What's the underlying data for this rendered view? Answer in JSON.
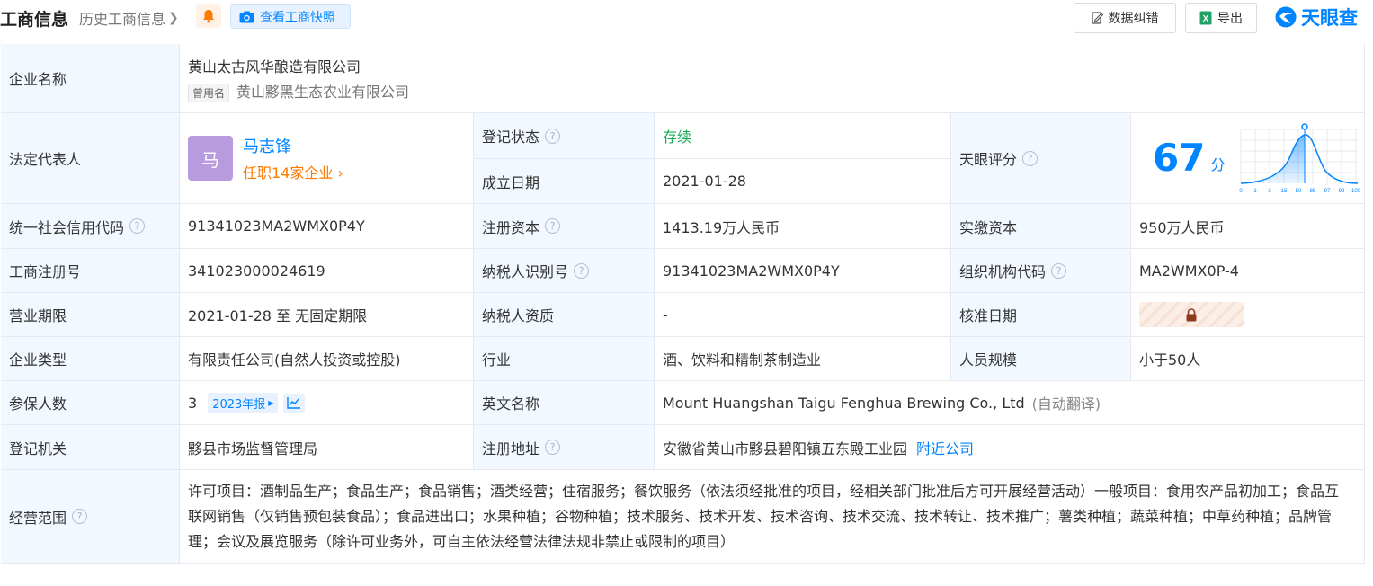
{
  "header": {
    "title": "工商信息",
    "history_link": "历史工商信息",
    "snapshot_button": "查看工商快照",
    "correct_button": "数据纠错",
    "export_button": "导出",
    "brand": "天眼查"
  },
  "company": {
    "label_name": "企业名称",
    "name": "黄山太古风华酿造有限公司",
    "former_tag": "曾用名",
    "former_name": "黄山黟黑生态农业有限公司"
  },
  "legal_rep": {
    "label": "法定代表人",
    "avatar_char": "马",
    "name": "马志锋",
    "jobs": "任职14家企业"
  },
  "reg_status": {
    "label": "登记状态",
    "value": "存续"
  },
  "founded": {
    "label": "成立日期",
    "value": "2021-01-28"
  },
  "score": {
    "label": "天眼评分",
    "value": "67",
    "unit": "分",
    "axis_ticks": [
      "0",
      "1",
      "3",
      "15",
      "50",
      "85",
      "97",
      "99",
      "100"
    ],
    "marker_tick": "50"
  },
  "rows": {
    "credit_code": {
      "label": "统一社会信用代码",
      "value": "91341023MA2WMX0P4Y"
    },
    "reg_capital": {
      "label": "注册资本",
      "value": "1413.19万人民币"
    },
    "paid_capital": {
      "label": "实缴资本",
      "value": "950万人民币"
    },
    "biz_reg_no": {
      "label": "工商注册号",
      "value": "341023000024619"
    },
    "taxpayer_id": {
      "label": "纳税人识别号",
      "value": "91341023MA2WMX0P4Y"
    },
    "org_code": {
      "label": "组织机构代码",
      "value": "MA2WMX0P-4"
    },
    "biz_term": {
      "label": "营业期限",
      "value": "2021-01-28 至 无固定期限"
    },
    "tax_qual": {
      "label": "纳税人资质",
      "value": "-"
    },
    "approve_date": {
      "label": "核准日期"
    },
    "company_type": {
      "label": "企业类型",
      "value": "有限责任公司(自然人投资或控股)"
    },
    "industry": {
      "label": "行业",
      "value": "酒、饮料和精制茶制造业"
    },
    "staff_size": {
      "label": "人员规模",
      "value": "小于50人"
    },
    "insured": {
      "label": "参保人数",
      "value": "3",
      "year_tag": "2023年报"
    },
    "english_name": {
      "label": "英文名称",
      "value": "Mount Huangshan Taigu Fenghua Brewing Co., Ltd",
      "note": "(自动翻译)"
    },
    "reg_authority": {
      "label": "登记机关",
      "value": "黟县市场监督管理局"
    },
    "reg_address": {
      "label": "注册地址",
      "value": "安徽省黄山市黟县碧阳镇五东殿工业园",
      "nearby": "附近公司"
    },
    "biz_scope": {
      "label": "经营范围",
      "value": "许可项目：酒制品生产；食品生产；食品销售；酒类经营；住宿服务；餐饮服务（依法须经批准的项目，经相关部门批准后方可开展经营活动）一般项目：食用农产品初加工；食品互联网销售（仅销售预包装食品）；食品进出口；水果种植；谷物种植；技术服务、技术开发、技术咨询、技术交流、技术转让、技术推广；薯类种植；蔬菜种植；中草药种植；品牌管理；会议及展览服务（除许可业务外，可自主依法经营法律法规非禁止或限制的项目）"
    }
  },
  "colors": {
    "accent": "#0084ff",
    "label_bg": "#f2f8ff",
    "status_green": "#1aab56",
    "jobs_orange": "#ff7a00"
  }
}
